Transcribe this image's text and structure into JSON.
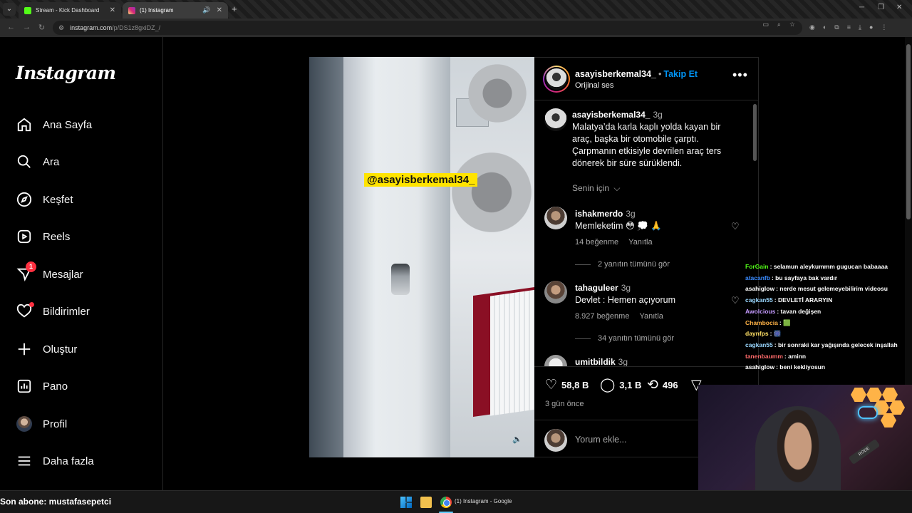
{
  "browser": {
    "tabs": [
      {
        "label": "Stream - Kick Dashboard",
        "favicon_color": "#53fc18"
      },
      {
        "label": "(1) Instagram",
        "favicon_color": "#e1306c"
      }
    ],
    "new_tab": "+",
    "url_site": "instagram.com",
    "url_path": "/p/DS1z8gxiDZ_/"
  },
  "instagram": {
    "logo": "Instagram",
    "nav": [
      {
        "label": "Ana Sayfa",
        "icon": "home-icon"
      },
      {
        "label": "Ara",
        "icon": "search-icon"
      },
      {
        "label": "Keşfet",
        "icon": "compass-icon"
      },
      {
        "label": "Reels",
        "icon": "reels-icon"
      },
      {
        "label": "Mesajlar",
        "icon": "messenger-icon",
        "badge": "1"
      },
      {
        "label": "Bildirimler",
        "icon": "heart-icon"
      },
      {
        "label": "Oluştur",
        "icon": "plus-icon"
      },
      {
        "label": "Pano",
        "icon": "dashboard-icon"
      },
      {
        "label": "Profil",
        "icon": "avatar"
      },
      {
        "label": "Daha fazla",
        "icon": "menu-icon"
      }
    ],
    "post": {
      "watermark": "@asayisberkemal34_",
      "author": "asayisberkemal34_",
      "follow": "Takip Et",
      "separator": "•",
      "audio": "Orijinal ses",
      "caption_time": "3g",
      "caption": "Malatya’da karla kaplı yolda kayan bir araç, başka bir otomobile çarptı. Çarpmanın etkisiyle devrilen araç ters dönerek bir süre sürüklendi.",
      "for_you": "Senin için",
      "comments": [
        {
          "user": "ishakmerdo",
          "time": "3g",
          "text": "Memleketim 😳 💭 🙏",
          "likes": "14 beğenme",
          "reply": "Yanıtla",
          "replies": "2 yanıtın tümünü gör"
        },
        {
          "user": "tahaguleer",
          "time": "3g",
          "text": "Devlet : Hemen açıyorum",
          "likes": "8.927 beğenme",
          "reply": "Yanıtla",
          "replies": "34 yanıtın tümünü gör"
        },
        {
          "user": "umitbildik",
          "time": "3g"
        }
      ],
      "likes": "58,8 B",
      "comment_count": "3,1 B",
      "reposts": "496",
      "posted": "3 gün önce",
      "add_comment_placeholder": "Yorum ekle..."
    }
  },
  "stream_chat": [
    {
      "user": "ForGain",
      "color": "#53fc18",
      "msg": ": selamun aleykummm gugucan babaaaa"
    },
    {
      "user": "atacanfb",
      "color": "#3a8bff",
      "msg": ": bu sayfaya bak vardır"
    },
    {
      "user": "asahiglow",
      "color": "#ffffff",
      "msg": ": nerde mesut gelemeyebilirim videosu"
    },
    {
      "user": "cagkan55",
      "color": "#9ad7ff",
      "msg": ": DEVLETİ ARARYIN"
    },
    {
      "user": "Awolcious",
      "color": "#c59bff",
      "msg": ": tavan değişen"
    },
    {
      "user": "Chambocia",
      "color": "#ffb347",
      "msg": ": 🟩"
    },
    {
      "user": "daynfps",
      "color": "#ffe066",
      "msg": ": 🎆"
    },
    {
      "user": "cagkan55",
      "color": "#9ad7ff",
      "msg": ": bir sonraki kar yağışında gelecek inşallah"
    },
    {
      "user": "tanenbaumm",
      "color": "#ff6b6b",
      "msg": ": aminn"
    },
    {
      "user": "asahiglow",
      "color": "#ffffff",
      "msg": ": beni kekliyosun"
    }
  ],
  "taskbar": {
    "last_sub": "Son abone: mustafasepetci",
    "active_app": "(1) Instagram - Google C"
  },
  "webcam": {
    "mic_text": "RODE"
  }
}
